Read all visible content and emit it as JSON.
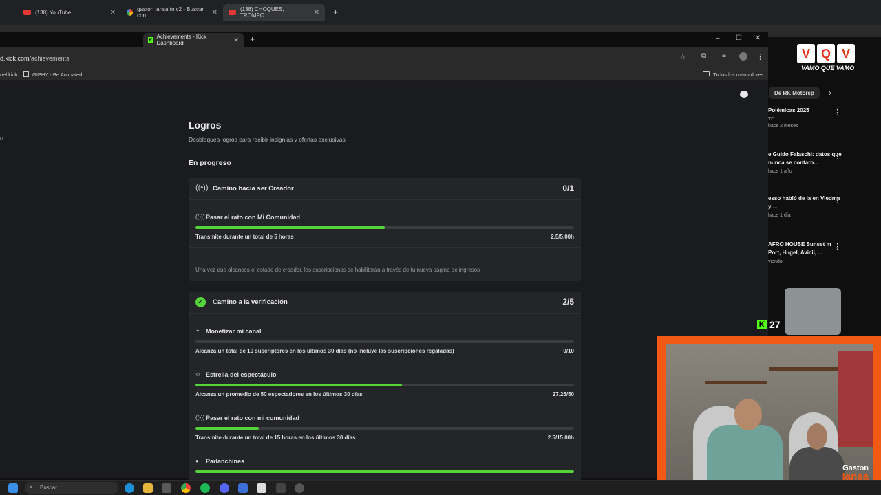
{
  "bg_browser": {
    "tabs": [
      {
        "label": "(138) YouTube"
      },
      {
        "label": "gaston iansa tn c2 - Buscar con"
      },
      {
        "label": "(138) CHOQUES, TROMPO"
      }
    ]
  },
  "window": {
    "tab_title": "Achievements - Kick Dashboard",
    "url_prefix": "d.kick.com",
    "url_path": "/achievements",
    "bookmarks": [
      "nel kick",
      "GIPHY - Be Animated"
    ],
    "all_bookmarks": "Todos los marcadores"
  },
  "page": {
    "title": "Logros",
    "subtitle": "Desbloquea logros para recibir insignias y ofertas exclusivas",
    "section": "En progreso",
    "cards": [
      {
        "title": "Camino hacia ser Creador",
        "count": "0/1",
        "achievements": [
          {
            "name": "Pasar el rato con Mi Comunidad",
            "desc": "Transmite durante un total de 5 horas",
            "value": "2.5/5.00h",
            "progress": 0.5
          }
        ],
        "note": "Una vez que alcances el estado de creador, las suscripciones se habilitarán a través de tu nueva página de ingresos"
      },
      {
        "title": "Camino a la verificación",
        "count": "2/5",
        "achievements": [
          {
            "name": "Monetizar mi canal",
            "desc": "Alcanza un total de 10 suscriptores en los últimos 30 días (no incluye las suscripciones regaladas)",
            "value": "0/10",
            "progress": 0
          },
          {
            "name": "Estrella del espectáculo",
            "desc": "Alcanza un promedio de 50 espectadores en los últimos 30 días",
            "value": "27.25/50",
            "progress": 0.545
          },
          {
            "name": "Pasar el rato con mi comunidad",
            "desc": "Transmite durante un total de 15 horas en los últimos 30 días",
            "value": "2.5/15.00h",
            "progress": 0.167
          },
          {
            "name": "Parlanchines",
            "desc": "",
            "value": "",
            "progress": 1
          }
        ]
      }
    ]
  },
  "yt_sidebar": {
    "chip": "De RK Motorsp",
    "items": [
      {
        "title": "Polémicas 2025",
        "meta1": "TC",
        "meta2": "hace 2 meses"
      },
      {
        "title": "e Guido Falaschi: datos que nunca se contaro...",
        "meta1": "",
        "meta2": "hace 1 año"
      },
      {
        "title": "esso habló de la en Viedma y ...",
        "meta1": "",
        "meta2": "hace 1 día"
      },
      {
        "title": "AFRO HOUSE Sunset m Port, Hugel, Avicii, ...",
        "meta1": "",
        "meta2": "viendo"
      }
    ]
  },
  "overlay": {
    "vqv_letters": [
      "V",
      "Q",
      "V"
    ],
    "vqv_sub": "VAMO QUE VAMO",
    "kick_viewers": "27",
    "cam_name_1": "Gaston",
    "cam_name_2": "Iansa"
  },
  "taskbar": {
    "search": "Buscar"
  }
}
